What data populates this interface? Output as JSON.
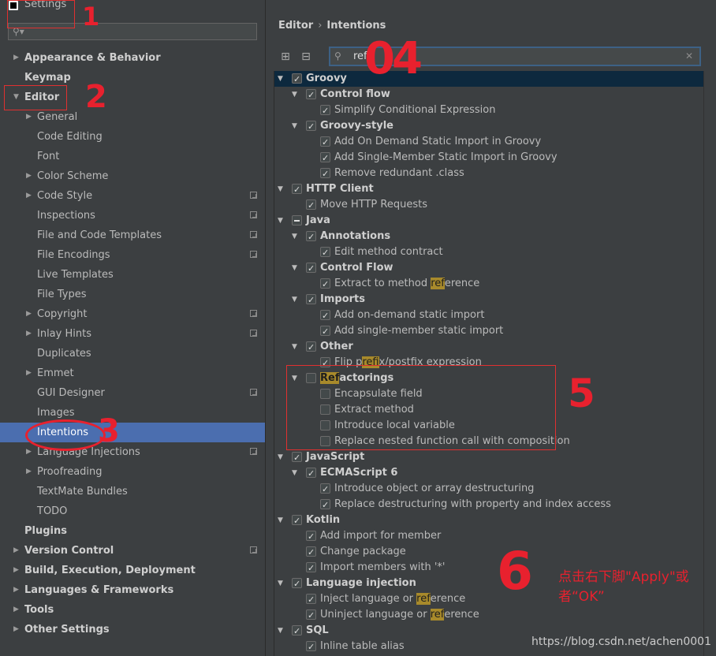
{
  "window": {
    "title": "Settings"
  },
  "left": {
    "search_placeholder": "",
    "items": [
      {
        "label": "Appearance & Behavior",
        "arrow": true,
        "bold": true,
        "indent": 0
      },
      {
        "label": "Keymap",
        "arrow": false,
        "bold": true,
        "indent": 0
      },
      {
        "label": "Editor",
        "arrow": true,
        "open": true,
        "bold": true,
        "indent": 0
      },
      {
        "label": "General",
        "arrow": true,
        "indent": 1
      },
      {
        "label": "Code Editing",
        "arrow": false,
        "indent": 1
      },
      {
        "label": "Font",
        "arrow": false,
        "indent": 1
      },
      {
        "label": "Color Scheme",
        "arrow": true,
        "indent": 1
      },
      {
        "label": "Code Style",
        "arrow": true,
        "indent": 1,
        "copy": true
      },
      {
        "label": "Inspections",
        "arrow": false,
        "indent": 1,
        "copy": true
      },
      {
        "label": "File and Code Templates",
        "arrow": false,
        "indent": 1,
        "copy": true
      },
      {
        "label": "File Encodings",
        "arrow": false,
        "indent": 1,
        "copy": true
      },
      {
        "label": "Live Templates",
        "arrow": false,
        "indent": 1
      },
      {
        "label": "File Types",
        "arrow": false,
        "indent": 1
      },
      {
        "label": "Copyright",
        "arrow": true,
        "indent": 1,
        "copy": true
      },
      {
        "label": "Inlay Hints",
        "arrow": true,
        "indent": 1,
        "copy": true
      },
      {
        "label": "Duplicates",
        "arrow": false,
        "indent": 1
      },
      {
        "label": "Emmet",
        "arrow": true,
        "indent": 1
      },
      {
        "label": "GUI Designer",
        "arrow": false,
        "indent": 1,
        "copy": true
      },
      {
        "label": "Images",
        "arrow": false,
        "indent": 1
      },
      {
        "label": "Intentions",
        "arrow": false,
        "indent": 1,
        "selected": true
      },
      {
        "label": "Language Injections",
        "arrow": true,
        "indent": 1,
        "copy": true
      },
      {
        "label": "Proofreading",
        "arrow": true,
        "indent": 1
      },
      {
        "label": "TextMate Bundles",
        "arrow": false,
        "indent": 1
      },
      {
        "label": "TODO",
        "arrow": false,
        "indent": 1
      },
      {
        "label": "Plugins",
        "arrow": false,
        "bold": true,
        "indent": 0
      },
      {
        "label": "Version Control",
        "arrow": true,
        "bold": true,
        "indent": 0,
        "copy": true
      },
      {
        "label": "Build, Execution, Deployment",
        "arrow": true,
        "bold": true,
        "indent": 0
      },
      {
        "label": "Languages & Frameworks",
        "arrow": true,
        "bold": true,
        "indent": 0
      },
      {
        "label": "Tools",
        "arrow": true,
        "bold": true,
        "indent": 0
      },
      {
        "label": "Other Settings",
        "arrow": true,
        "bold": true,
        "indent": 0
      }
    ]
  },
  "breadcrumb": {
    "parent": "Editor",
    "sep": "›",
    "current": "Intentions"
  },
  "intentions_search": {
    "value": "ref"
  },
  "intentions": [
    {
      "level": 0,
      "toggle": true,
      "state": "checked",
      "bold": true,
      "pre": "Groovy",
      "hl": true
    },
    {
      "level": 1,
      "toggle": true,
      "state": "checked",
      "bold": true,
      "pre": "Control flow"
    },
    {
      "level": 2,
      "state": "checked",
      "pre": "Simplify Conditional Expression"
    },
    {
      "level": 1,
      "toggle": true,
      "state": "checked",
      "bold": true,
      "pre": "Groovy-style"
    },
    {
      "level": 2,
      "state": "checked",
      "pre": "Add On Demand Static Import in Groovy"
    },
    {
      "level": 2,
      "state": "checked",
      "pre": "Add Single-Member Static Import in Groovy"
    },
    {
      "level": 2,
      "state": "checked",
      "pre": "Remove redundant .class"
    },
    {
      "level": 0,
      "toggle": true,
      "state": "checked",
      "bold": true,
      "pre": "HTTP Client"
    },
    {
      "level": 1,
      "state": "checked",
      "pre": "Move HTTP Requests"
    },
    {
      "level": 0,
      "toggle": true,
      "state": "partial",
      "bold": true,
      "pre": "Java"
    },
    {
      "level": 1,
      "toggle": true,
      "state": "checked",
      "bold": true,
      "pre": "Annotations"
    },
    {
      "level": 2,
      "state": "checked",
      "pre": "Edit method contract"
    },
    {
      "level": 1,
      "toggle": true,
      "state": "checked",
      "bold": true,
      "pre": "Control Flow"
    },
    {
      "level": 2,
      "state": "checked",
      "pre": "Extract to method ",
      "mark": "ref",
      "post": "erence"
    },
    {
      "level": 1,
      "toggle": true,
      "state": "checked",
      "bold": true,
      "pre": "Imports"
    },
    {
      "level": 2,
      "state": "checked",
      "pre": "Add on-demand static import"
    },
    {
      "level": 2,
      "state": "checked",
      "pre": "Add single-member static import"
    },
    {
      "level": 1,
      "toggle": true,
      "state": "checked",
      "bold": true,
      "pre": "Other"
    },
    {
      "level": 2,
      "state": "checked",
      "pre": "Flip p",
      "mark": "ref",
      "post": "ix/postfix expression"
    },
    {
      "level": 1,
      "toggle": true,
      "state": "none",
      "bold": true,
      "pre": "",
      "mark": "Ref",
      "post": "actorings"
    },
    {
      "level": 2,
      "state": "none",
      "pre": "Encapsulate field"
    },
    {
      "level": 2,
      "state": "none",
      "pre": "Extract method"
    },
    {
      "level": 2,
      "state": "none",
      "pre": "Introduce local variable"
    },
    {
      "level": 2,
      "state": "none",
      "pre": "Replace nested function call with composition"
    },
    {
      "level": 0,
      "toggle": true,
      "state": "checked",
      "bold": true,
      "pre": "JavaScript"
    },
    {
      "level": 1,
      "toggle": true,
      "state": "checked",
      "bold": true,
      "pre": "ECMAScript 6"
    },
    {
      "level": 2,
      "state": "checked",
      "pre": "Introduce object or array destructuring"
    },
    {
      "level": 2,
      "state": "checked",
      "pre": "Replace destructuring with property and index access"
    },
    {
      "level": 0,
      "toggle": true,
      "state": "checked",
      "bold": true,
      "pre": "Kotlin"
    },
    {
      "level": 1,
      "state": "checked",
      "pre": "Add import for member"
    },
    {
      "level": 1,
      "state": "checked",
      "pre": "Change package"
    },
    {
      "level": 1,
      "state": "checked",
      "pre": "Import members with '*'"
    },
    {
      "level": 0,
      "toggle": true,
      "state": "checked",
      "bold": true,
      "pre": "Language injection"
    },
    {
      "level": 1,
      "state": "checked",
      "pre": "Inject language or ",
      "mark": "ref",
      "post": "erence"
    },
    {
      "level": 1,
      "state": "checked",
      "pre": "Uninject language or ",
      "mark": "ref",
      "post": "erence"
    },
    {
      "level": 0,
      "toggle": true,
      "state": "checked",
      "bold": true,
      "pre": "SQL"
    },
    {
      "level": 1,
      "state": "checked",
      "pre": "Inline table alias"
    }
  ],
  "annotations": {
    "n1": "1",
    "n2": "2",
    "n3": "3",
    "n4": "04",
    "n5": "5",
    "n6": "6",
    "note_line1": "点击右下脚\"Apply\"或",
    "note_line2": "者“OK”"
  },
  "watermark": "https://blog.csdn.net/achen0001",
  "colors": {
    "selection": "#4b6eaf",
    "annotation": "#e8212e",
    "match_highlight": "#a88a2b"
  }
}
